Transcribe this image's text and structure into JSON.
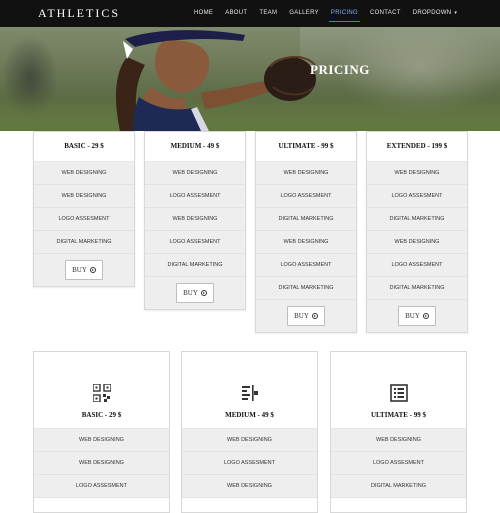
{
  "navbar": {
    "brand": "ATHLETICS",
    "links": [
      {
        "label": "HOME",
        "active": false
      },
      {
        "label": "ABOUT",
        "active": false
      },
      {
        "label": "TEAM",
        "active": false
      },
      {
        "label": "GALLERY",
        "active": false
      },
      {
        "label": "PRICING",
        "active": true
      },
      {
        "label": "CONTACT",
        "active": false
      },
      {
        "label": "DROPDOWN",
        "active": false,
        "caret": "▾"
      }
    ]
  },
  "hero": {
    "title": "PRICING"
  },
  "pricing_table_1": [
    {
      "title": "BASIC - 29 $",
      "features": [
        "WEB DESIGNING",
        "WEB DESIGNING",
        "LOGO ASSESMENT",
        "DIGITAL MARKETING"
      ],
      "button": "BUY"
    },
    {
      "title": "MEDIUM - 49 $",
      "features": [
        "WEB DESIGNING",
        "LOGO ASSESMENT",
        "WEB DESIGNING",
        "LOGO ASSESMENT",
        "DIGITAL MARKETING"
      ],
      "button": "BUY"
    },
    {
      "title": "ULTIMATE - 99 $",
      "features": [
        "WEB DESIGNING",
        "LOGO ASSESMENT",
        "DIGITAL MARKETING",
        "WEB DESIGNING",
        "LOGO ASSESMENT",
        "DIGITAL MARKETING"
      ],
      "button": "BUY"
    },
    {
      "title": "EXTENDED - 199 $",
      "features": [
        "WEB DESIGNING",
        "LOGO ASSESMENT",
        "DIGITAL MARKETING",
        "WEB DESIGNING",
        "LOGO ASSESMENT",
        "DIGITAL MARKETING"
      ],
      "button": "BUY"
    }
  ],
  "pricing_table_2": [
    {
      "icon": "qr-code-icon",
      "title": "BASIC - 29 $",
      "features": [
        "WEB DESIGNING",
        "WEB DESIGNING",
        "LOGO ASSESMENT"
      ]
    },
    {
      "icon": "align-bars-icon",
      "title": "MEDIUM - 49 $",
      "features": [
        "WEB DESIGNING",
        "LOGO ASSESMENT",
        "WEB DESIGNING"
      ]
    },
    {
      "icon": "list-document-icon",
      "title": "ULTIMATE - 99 $",
      "features": [
        "WEB DESIGNING",
        "LOGO ASSESMENT",
        "DIGITAL MARKETING"
      ]
    }
  ],
  "colors": {
    "navbar_bg": "#111111",
    "active_link": "#7fb0ff",
    "feature_bg": "#eeeeee",
    "border": "#d8d8d8"
  }
}
